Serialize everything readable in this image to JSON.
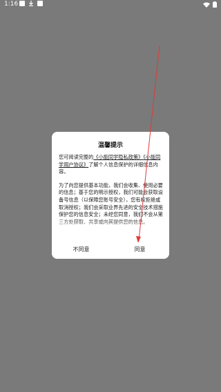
{
  "status_bar": {
    "time": "1:16",
    "left_icons": [
      "image-icon",
      "download-icon",
      "notification-icon"
    ],
    "right_icons": [
      "wifi-icon",
      "battery-icon"
    ]
  },
  "dialog": {
    "title": "温馨提示",
    "para1_prefix": "您可阅读完整的",
    "privacy_link": "《小能同学隐私政策》",
    "user_link": "《小能同学用户协议》",
    "para1_suffix": "了解个人信息保护的详细信息内容。",
    "para2": "为了向您提供基本功能，我们会收集、使用必要的信息；基于您的明示授权，我们可能会获取设备号信息（以保障您账号安全），您有权拒绝或取消授权；我们会采取业界先进的安全技术措施保护您的信息安全；未经您同意，我们不会从第三方处获取、共享或向其提供您的信息。",
    "disagree_label": "不同意",
    "agree_label": "同意"
  },
  "colors": {
    "overlay": "#7a7a7a",
    "arrow": "#e03a3a"
  }
}
